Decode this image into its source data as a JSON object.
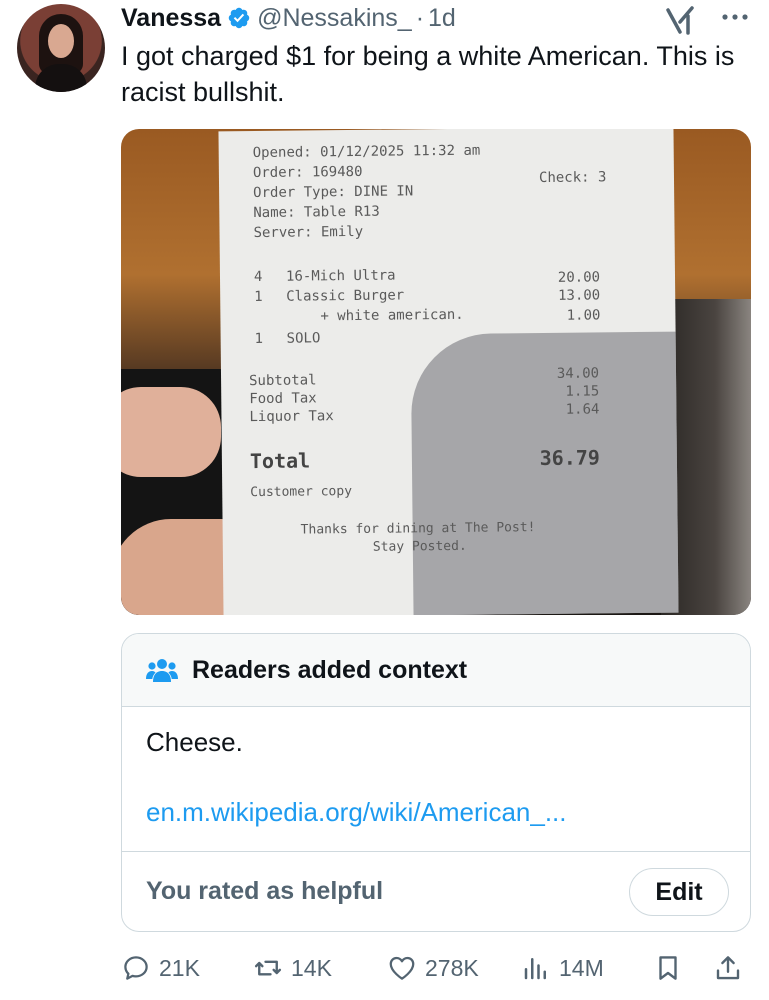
{
  "author": {
    "display_name": "Vanessa",
    "handle": "@Nessakins_",
    "separator": "·",
    "time": "1d"
  },
  "tweet": {
    "text": "I got charged $1 for being a white American. This is racist bullshit."
  },
  "receipt": {
    "opened": "Opened: 01/12/2025 11:32 am",
    "order": "Order: 169480",
    "check": "Check: 3",
    "order_type": "Order Type: DINE IN",
    "name": "Name: Table R13",
    "server": "Server: Emily",
    "items": [
      {
        "qty": "4",
        "name": "16-Mich Ultra",
        "price": "20.00"
      },
      {
        "qty": "1",
        "name": "Classic Burger",
        "price": "13.00"
      },
      {
        "qty": "",
        "name": "+ white american.",
        "price": "1.00"
      },
      {
        "qty": "1",
        "name": "SOLO",
        "price": ""
      }
    ],
    "subtotal_label": "Subtotal",
    "subtotal": "34.00",
    "food_tax_label": "Food Tax",
    "food_tax": "1.15",
    "liquor_tax_label": "Liquor Tax",
    "liquor_tax": "1.64",
    "total_label": "Total",
    "total": "36.79",
    "copy_label": "Customer copy",
    "thanks": "Thanks for dining at The Post!",
    "tagline": "Stay Posted."
  },
  "community_note": {
    "title": "Readers added context",
    "text": "Cheese.",
    "link": "en.m.wikipedia.org/wiki/American_...",
    "rated_text": "You rated as helpful",
    "edit_label": "Edit"
  },
  "actions": {
    "replies": "21K",
    "reposts": "14K",
    "likes": "278K",
    "views": "14M"
  },
  "colors": {
    "text": "#0f1419",
    "secondary": "#536471",
    "link": "#1d9bf0",
    "border": "#cfd9de",
    "verified": "#1d9bf0"
  },
  "icons": [
    "verified-badge-icon",
    "grok-icon",
    "more-icon",
    "people-icon",
    "reply-icon",
    "repost-icon",
    "like-icon",
    "views-icon",
    "bookmark-icon",
    "share-icon"
  ]
}
